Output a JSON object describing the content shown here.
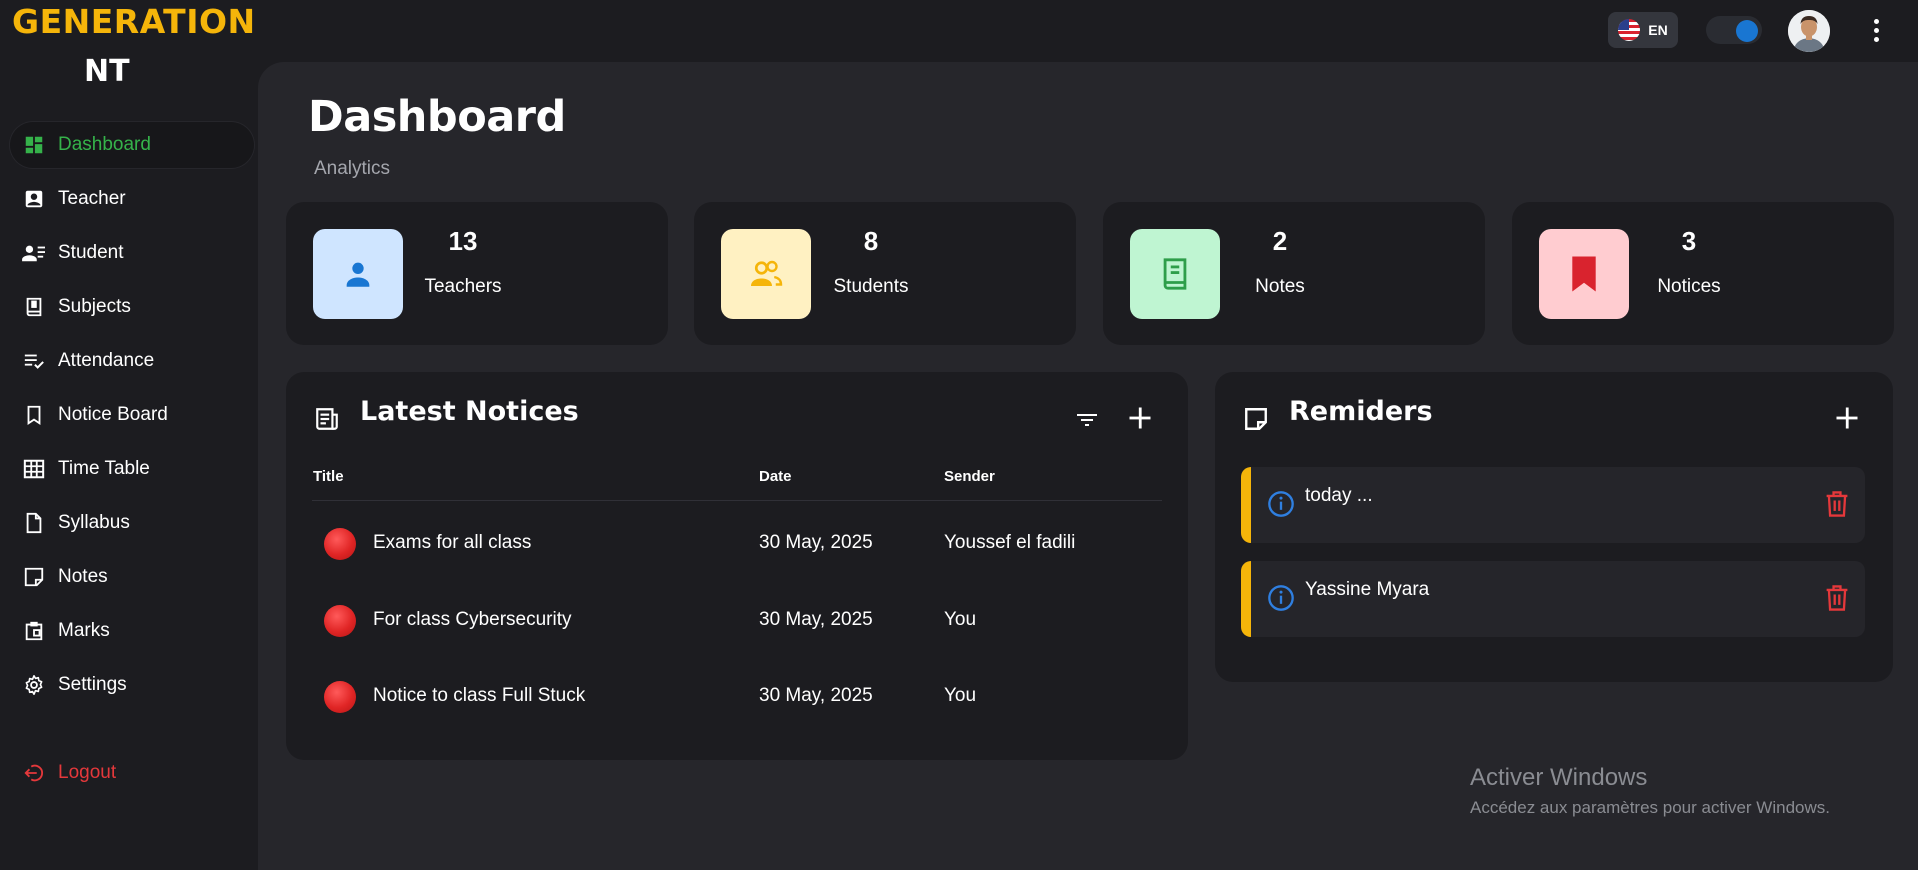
{
  "brand": {
    "line1": "GENERATION",
    "line2": "NT",
    "color": "#f5b50a"
  },
  "topbar": {
    "language": "EN",
    "theme_toggle_on": true,
    "accent": "#1976d2"
  },
  "sidebar": {
    "items": [
      {
        "label": "Dashboard",
        "icon": "dashboard-icon",
        "active": true
      },
      {
        "label": "Teacher",
        "icon": "teacher-icon"
      },
      {
        "label": "Student",
        "icon": "student-icon"
      },
      {
        "label": "Subjects",
        "icon": "subjects-icon"
      },
      {
        "label": "Attendance",
        "icon": "attendance-icon"
      },
      {
        "label": "Notice Board",
        "icon": "bookmark-icon"
      },
      {
        "label": "Time Table",
        "icon": "grid-icon"
      },
      {
        "label": "Syllabus",
        "icon": "file-icon"
      },
      {
        "label": "Notes",
        "icon": "note-icon"
      },
      {
        "label": "Marks",
        "icon": "clipboard-icon"
      },
      {
        "label": "Settings",
        "icon": "gear-icon"
      }
    ],
    "logout": "Logout",
    "active_color": "#35b24a",
    "logout_color": "#e5383b"
  },
  "header": {
    "title": "Dashboard",
    "subtitle": "Analytics"
  },
  "stats": [
    {
      "value": "13",
      "label": "Teachers",
      "icon": "person-icon",
      "bg": "#cfe5ff",
      "fg": "#1976d2"
    },
    {
      "value": "8",
      "label": "Students",
      "icon": "group-icon",
      "bg": "#fff1c2",
      "fg": "#f5b50a"
    },
    {
      "value": "2",
      "label": "Notes",
      "icon": "book-icon",
      "bg": "#bff5d2",
      "fg": "#2e9e4a"
    },
    {
      "value": "3",
      "label": "Notices",
      "icon": "bookmark-icon",
      "bg": "#ffccd0",
      "fg": "#d9232e"
    }
  ],
  "notices": {
    "title": "Latest Notices",
    "columns": [
      "Title",
      "Date",
      "Sender"
    ],
    "rows": [
      {
        "title": "Exams for all class",
        "date": "30 May, 2025",
        "sender": "Youssef el fadili"
      },
      {
        "title": "For class Cybersecurity",
        "date": "30 May, 2025",
        "sender": "You"
      },
      {
        "title": "Notice to class Full Stuck",
        "date": "30 May, 2025",
        "sender": "You"
      }
    ]
  },
  "reminders": {
    "title": "Remiders",
    "items": [
      {
        "text": "today ..."
      },
      {
        "text": "Yassine Myara"
      }
    ]
  },
  "watermark": {
    "title": "Activer Windows",
    "subtitle": "Accédez aux paramètres pour activer Windows."
  }
}
